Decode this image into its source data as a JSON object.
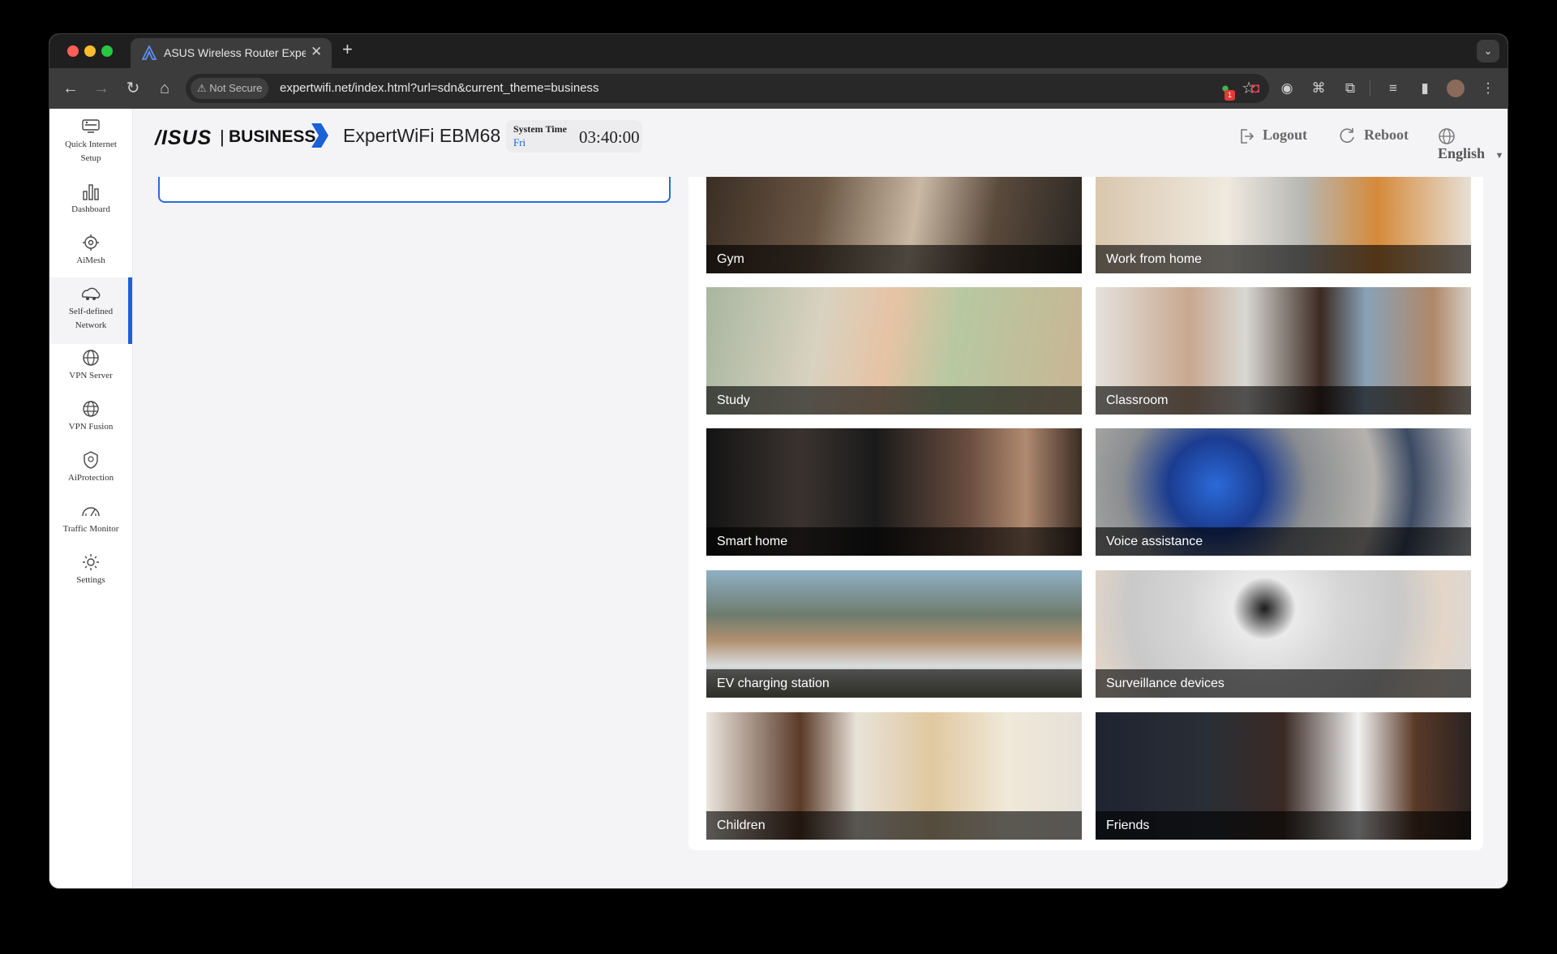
{
  "browser": {
    "tab_title": "ASUS Wireless Router Exper",
    "not_secure": "Not Secure",
    "url": "expertwifi.net/index.html?url=sdn&current_theme=business",
    "ext_badge": "1"
  },
  "header": {
    "brand": "/ISUS",
    "separator": "|",
    "business": "BUSINESS",
    "model": "ExpertWiFi EBM68",
    "system_time_label": "System Time",
    "system_time_day": "Fri",
    "system_time_value": "03:40:00",
    "logout": "Logout",
    "reboot": "Reboot",
    "language": "English"
  },
  "sidebar": {
    "items": [
      {
        "label1": "Quick Internet",
        "label2": "Setup",
        "icon": "quick-setup-icon"
      },
      {
        "label1": "Dashboard",
        "label2": "",
        "icon": "dashboard-icon"
      },
      {
        "label1": "AiMesh",
        "label2": "",
        "icon": "aimesh-icon"
      },
      {
        "label1": "Self-defined",
        "label2": "Network",
        "icon": "sdn-icon"
      },
      {
        "label1": "VPN Server",
        "label2": "",
        "icon": "vpn-server-icon"
      },
      {
        "label1": "VPN Fusion",
        "label2": "",
        "icon": "vpn-fusion-icon"
      },
      {
        "label1": "AiProtection",
        "label2": "",
        "icon": "shield-icon"
      },
      {
        "label1": "Traffic Monitor",
        "label2": "",
        "icon": "traffic-monitor-icon"
      },
      {
        "label1": "Settings",
        "label2": "",
        "icon": "settings-icon"
      }
    ],
    "active_index": 3
  },
  "scenarios": [
    {
      "label": "Gym"
    },
    {
      "label": "Work from home"
    },
    {
      "label": "Study"
    },
    {
      "label": "Classroom"
    },
    {
      "label": "Smart home"
    },
    {
      "label": "Voice assistance"
    },
    {
      "label": "EV charging station"
    },
    {
      "label": "Surveillance devices"
    },
    {
      "label": "Children"
    },
    {
      "label": "Friends"
    }
  ],
  "colors": {
    "accent": "#1a61d8"
  }
}
